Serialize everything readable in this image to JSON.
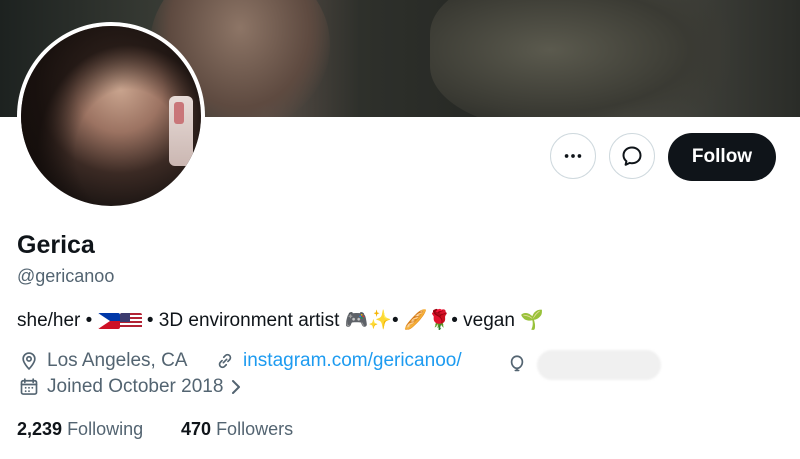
{
  "profile": {
    "name": "Gerica",
    "handle": "@gericanoo",
    "bio": {
      "prefix": "she/her •",
      "middle": "• 3D environment artist 🎮✨• 🥖🌹• vegan 🌱",
      "flags": [
        "philippines-flag",
        "usa-flag"
      ]
    },
    "location": "Los Angeles, CA",
    "website": "instagram.com/gericanoo/",
    "joined": "Joined October 2018",
    "following_count": "2,239",
    "following_label": "Following",
    "followers_count": "470",
    "followers_label": "Followers"
  },
  "actions": {
    "more_icon": "more-horizontal-icon",
    "message_icon": "message-bubble-icon",
    "follow_label": "Follow"
  },
  "icons": {
    "location": "location-pin-icon",
    "link": "link-icon",
    "birthday": "balloon-icon",
    "calendar": "calendar-icon",
    "chevron": "chevron-right-icon"
  },
  "colors": {
    "accent": "#1d9bf0",
    "follow_bg": "#0f1419",
    "muted": "#536471"
  }
}
